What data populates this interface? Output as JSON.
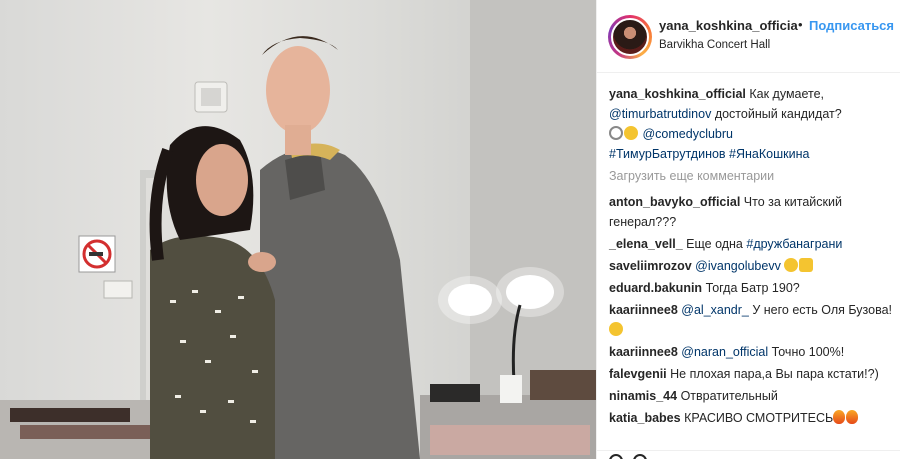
{
  "header": {
    "username": "yana_koshkina_officia",
    "dot": "•",
    "follow_label": "Подписаться",
    "location": "Barvikha Concert Hall"
  },
  "caption": {
    "username": "yana_koshkina_official",
    "text_1": "Как думаете,",
    "mention": "@timurbatrutdinov",
    "text_2": "достойный кандидат?",
    "mention_2": "@comedyclubru",
    "hashtags": "#ТимурБатрутдинов #ЯнаКошкина"
  },
  "load_more": "Загрузить еще комментарии",
  "comments": [
    {
      "user": "anton_bavyko_official",
      "text": "Что за китайский генерал???"
    },
    {
      "user": "_elena_vell_",
      "text": "Еще одна",
      "tag": "#дружбанаграни"
    },
    {
      "user": "saveliimrozov",
      "mention": "@ivangolubevv"
    },
    {
      "user": "eduard.bakunin",
      "text": "Тогда Батр 190?"
    },
    {
      "user": "kaariinnee8",
      "mention": "@al_xandr_",
      "text": "У него есть Оля Бузова!"
    },
    {
      "user": "kaariinnee8",
      "mention": "@naran_official",
      "text": "Точно 100%!"
    },
    {
      "user": "falevgenii",
      "text": "Не плохая пара,а Вы пара кстати!?)"
    },
    {
      "user": "ninamis_44",
      "text": "Отвратительный"
    },
    {
      "user": "katia_babes",
      "text": "КРАСИВО СМОТРИТЕСЬ"
    }
  ],
  "colors": {
    "link_blue": "#3897f0",
    "mention_blue": "#003569",
    "muted_gray": "#999999",
    "text": "#262626"
  },
  "icons": {
    "no_smoking_sign": "no-smoking-sign-icon",
    "heart": "heart-icon",
    "comment": "comment-icon"
  }
}
